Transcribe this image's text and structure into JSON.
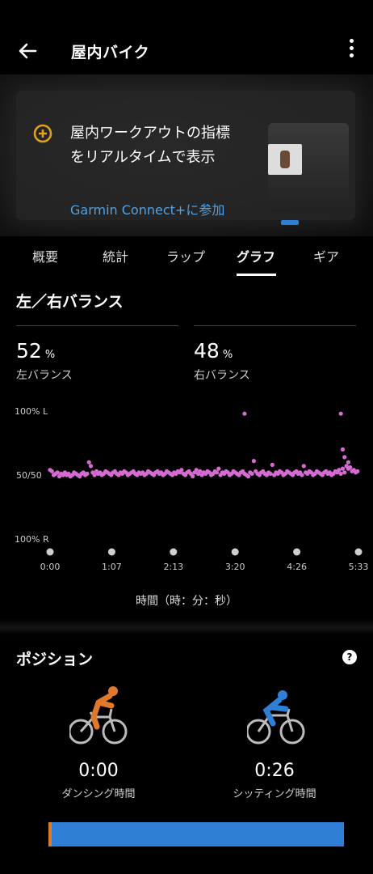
{
  "header": {
    "title": "屋内バイク"
  },
  "promo": {
    "text_line1": "屋内ワークアウトの指標",
    "text_line2": "をリアルタイムで表示",
    "link": "Garmin Connect+に参加"
  },
  "tabs": [
    {
      "label": "概要"
    },
    {
      "label": "統計"
    },
    {
      "label": "ラップ"
    },
    {
      "label": "グラフ",
      "active": true
    },
    {
      "label": "ギア"
    }
  ],
  "balance": {
    "title": "左／右バランス",
    "left_value": "52",
    "left_unit": "%",
    "left_label": "左バランス",
    "right_value": "48",
    "right_unit": "%",
    "right_label": "右バランス"
  },
  "chart_data": {
    "type": "scatter",
    "y_ticks": [
      "100% L",
      "50/50",
      "100% R"
    ],
    "x_ticks": [
      "0:00",
      "1:07",
      "2:13",
      "3:20",
      "4:26",
      "5:33"
    ],
    "xlabel": "時間（時：分：秒）",
    "color": "#d66bd3",
    "x_range_s": [
      0,
      333
    ],
    "y_range_pct_left": [
      0,
      100
    ],
    "series": [
      {
        "points_s_pct": [
          [
            0,
            54
          ],
          [
            2,
            53
          ],
          [
            4,
            50
          ],
          [
            6,
            51
          ],
          [
            8,
            52
          ],
          [
            10,
            49
          ],
          [
            12,
            51
          ],
          [
            14,
            50
          ],
          [
            16,
            52
          ],
          [
            18,
            50
          ],
          [
            20,
            51
          ],
          [
            22,
            49
          ],
          [
            24,
            50
          ],
          [
            26,
            52
          ],
          [
            28,
            51
          ],
          [
            30,
            50
          ],
          [
            32,
            49
          ],
          [
            34,
            51
          ],
          [
            36,
            52
          ],
          [
            38,
            50
          ],
          [
            40,
            51
          ],
          [
            42,
            60
          ],
          [
            44,
            57
          ],
          [
            46,
            52
          ],
          [
            48,
            50
          ],
          [
            50,
            53
          ],
          [
            52,
            51
          ],
          [
            54,
            52
          ],
          [
            56,
            50
          ],
          [
            58,
            51
          ],
          [
            60,
            53
          ],
          [
            62,
            52
          ],
          [
            64,
            51
          ],
          [
            66,
            50
          ],
          [
            68,
            52
          ],
          [
            70,
            53
          ],
          [
            72,
            51
          ],
          [
            74,
            50
          ],
          [
            76,
            52
          ],
          [
            78,
            51
          ],
          [
            80,
            53
          ],
          [
            82,
            52
          ],
          [
            84,
            50
          ],
          [
            86,
            51
          ],
          [
            88,
            52
          ],
          [
            90,
            53
          ],
          [
            92,
            51
          ],
          [
            94,
            50
          ],
          [
            96,
            52
          ],
          [
            98,
            51
          ],
          [
            100,
            52
          ],
          [
            102,
            50
          ],
          [
            104,
            51
          ],
          [
            106,
            53
          ],
          [
            108,
            52
          ],
          [
            110,
            51
          ],
          [
            112,
            50
          ],
          [
            114,
            52
          ],
          [
            116,
            53
          ],
          [
            118,
            51
          ],
          [
            120,
            52
          ],
          [
            122,
            50
          ],
          [
            124,
            51
          ],
          [
            126,
            53
          ],
          [
            128,
            52
          ],
          [
            130,
            51
          ],
          [
            132,
            50
          ],
          [
            134,
            52
          ],
          [
            136,
            51
          ],
          [
            138,
            53
          ],
          [
            140,
            52
          ],
          [
            142,
            54
          ],
          [
            144,
            51
          ],
          [
            146,
            50
          ],
          [
            148,
            52
          ],
          [
            150,
            53
          ],
          [
            152,
            51
          ],
          [
            154,
            49
          ],
          [
            156,
            52
          ],
          [
            158,
            54
          ],
          [
            160,
            51
          ],
          [
            162,
            53
          ],
          [
            164,
            50
          ],
          [
            166,
            52
          ],
          [
            168,
            51
          ],
          [
            170,
            53
          ],
          [
            172,
            52
          ],
          [
            174,
            50
          ],
          [
            176,
            51
          ],
          [
            178,
            53
          ],
          [
            180,
            52
          ],
          [
            182,
            55
          ],
          [
            184,
            50
          ],
          [
            186,
            52
          ],
          [
            188,
            51
          ],
          [
            190,
            53
          ],
          [
            192,
            52
          ],
          [
            194,
            50
          ],
          [
            196,
            51
          ],
          [
            198,
            53
          ],
          [
            200,
            52
          ],
          [
            202,
            51
          ],
          [
            204,
            50
          ],
          [
            206,
            52
          ],
          [
            208,
            53
          ],
          [
            210,
            51
          ],
          [
            212,
            50
          ],
          [
            214,
            49
          ],
          [
            216,
            52
          ],
          [
            218,
            51
          ],
          [
            220,
            61
          ],
          [
            222,
            53
          ],
          [
            224,
            51
          ],
          [
            226,
            50
          ],
          [
            228,
            52
          ],
          [
            230,
            53
          ],
          [
            232,
            51
          ],
          [
            234,
            50
          ],
          [
            236,
            52
          ],
          [
            238,
            51
          ],
          [
            240,
            58
          ],
          [
            242,
            50
          ],
          [
            244,
            52
          ],
          [
            246,
            51
          ],
          [
            248,
            53
          ],
          [
            250,
            52
          ],
          [
            252,
            50
          ],
          [
            254,
            51
          ],
          [
            256,
            53
          ],
          [
            258,
            52
          ],
          [
            260,
            51
          ],
          [
            262,
            50
          ],
          [
            264,
            52
          ],
          [
            266,
            53
          ],
          [
            268,
            51
          ],
          [
            270,
            52
          ],
          [
            272,
            50
          ],
          [
            274,
            57
          ],
          [
            276,
            52
          ],
          [
            278,
            51
          ],
          [
            280,
            53
          ],
          [
            282,
            52
          ],
          [
            284,
            50
          ],
          [
            286,
            51
          ],
          [
            288,
            53
          ],
          [
            290,
            52
          ],
          [
            292,
            51
          ],
          [
            294,
            50
          ],
          [
            296,
            52
          ],
          [
            298,
            53
          ],
          [
            300,
            51
          ],
          [
            302,
            52
          ],
          [
            304,
            50
          ],
          [
            306,
            51
          ],
          [
            308,
            53
          ],
          [
            310,
            52
          ],
          [
            312,
            54
          ],
          [
            314,
            51
          ],
          [
            316,
            55
          ],
          [
            318,
            52
          ],
          [
            320,
            57
          ],
          [
            322,
            55
          ],
          [
            324,
            56
          ],
          [
            326,
            53
          ],
          [
            328,
            54
          ],
          [
            330,
            52
          ],
          [
            332,
            53
          ],
          [
            210,
            98
          ],
          [
            314,
            98
          ],
          [
            316,
            70
          ],
          [
            318,
            64
          ],
          [
            322,
            60
          ]
        ]
      }
    ]
  },
  "position": {
    "title": "ポジション",
    "help": "?",
    "standing_time": "0:00",
    "standing_label": "ダンシング時間",
    "seated_time": "0:26",
    "seated_label": "シッティング時間",
    "standing_fraction": 0.01,
    "standing_color": "#e07a2a",
    "seated_color": "#2f7fd6"
  }
}
